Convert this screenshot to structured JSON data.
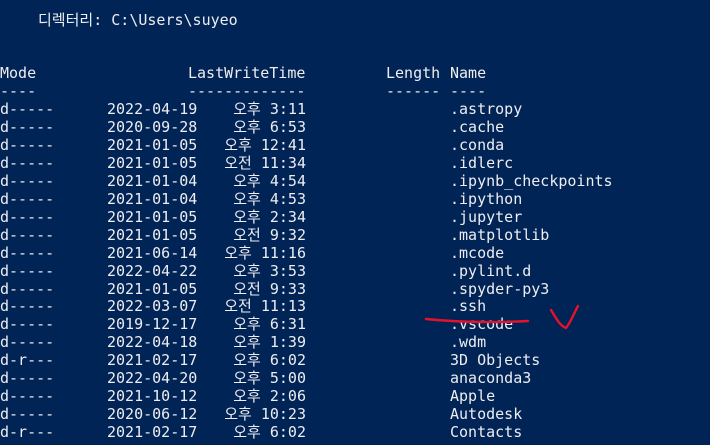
{
  "console": {
    "directory_line": "디렉터리: C:\\Users\\suyeo",
    "headers": {
      "mode": "Mode",
      "lastwritetime": "LastWriteTime",
      "length": "Length",
      "name": "Name"
    },
    "underlines": {
      "mode": "----",
      "lastwritetime": "-------------",
      "length": "------",
      "name": "----"
    },
    "rows": [
      {
        "mode": "d-----",
        "date": "2022-04-19",
        "time": "오후 3:11",
        "name": ".astropy"
      },
      {
        "mode": "d-----",
        "date": "2020-09-28",
        "time": "오후 6:53",
        "name": ".cache"
      },
      {
        "mode": "d-----",
        "date": "2021-01-05",
        "time": "오후 12:41",
        "name": ".conda"
      },
      {
        "mode": "d-----",
        "date": "2021-01-05",
        "time": "오전 11:34",
        "name": ".idlerc"
      },
      {
        "mode": "d-----",
        "date": "2021-01-04",
        "time": "오후 4:54",
        "name": ".ipynb_checkpoints"
      },
      {
        "mode": "d-----",
        "date": "2021-01-04",
        "time": "오후 4:53",
        "name": ".ipython"
      },
      {
        "mode": "d-----",
        "date": "2021-01-05",
        "time": "오후 2:34",
        "name": ".jupyter"
      },
      {
        "mode": "d-----",
        "date": "2021-01-05",
        "time": "오전 9:32",
        "name": ".matplotlib"
      },
      {
        "mode": "d-----",
        "date": "2021-06-14",
        "time": "오후 11:16",
        "name": ".mcode"
      },
      {
        "mode": "d-----",
        "date": "2022-04-22",
        "time": "오후 3:53",
        "name": ".pylint.d"
      },
      {
        "mode": "d-----",
        "date": "2021-01-05",
        "time": "오전 9:33",
        "name": ".spyder-py3"
      },
      {
        "mode": "d-----",
        "date": "2022-03-07",
        "time": "오전 11:13",
        "name": ".ssh"
      },
      {
        "mode": "d-----",
        "date": "2019-12-17",
        "time": "오후 6:31",
        "name": ".vscode"
      },
      {
        "mode": "d-----",
        "date": "2022-04-18",
        "time": "오후 1:39",
        "name": ".wdm"
      },
      {
        "mode": "d-r---",
        "date": "2021-02-17",
        "time": "오후 6:02",
        "name": "3D Objects"
      },
      {
        "mode": "d-----",
        "date": "2022-04-20",
        "time": "오후 5:00",
        "name": "anaconda3"
      },
      {
        "mode": "d-----",
        "date": "2021-10-12",
        "time": "오후 2:06",
        "name": "Apple"
      },
      {
        "mode": "d-----",
        "date": "2020-06-12",
        "time": "오후 10:23",
        "name": "Autodesk"
      },
      {
        "mode": "d-r---",
        "date": "2021-02-17",
        "time": "오후 6:02",
        "name": "Contacts"
      }
    ]
  },
  "annotation": {
    "color": "#e8112b",
    "mark": "underline-and-checkmark"
  },
  "colors": {
    "background": "#012456",
    "text": "#eeedf0"
  }
}
